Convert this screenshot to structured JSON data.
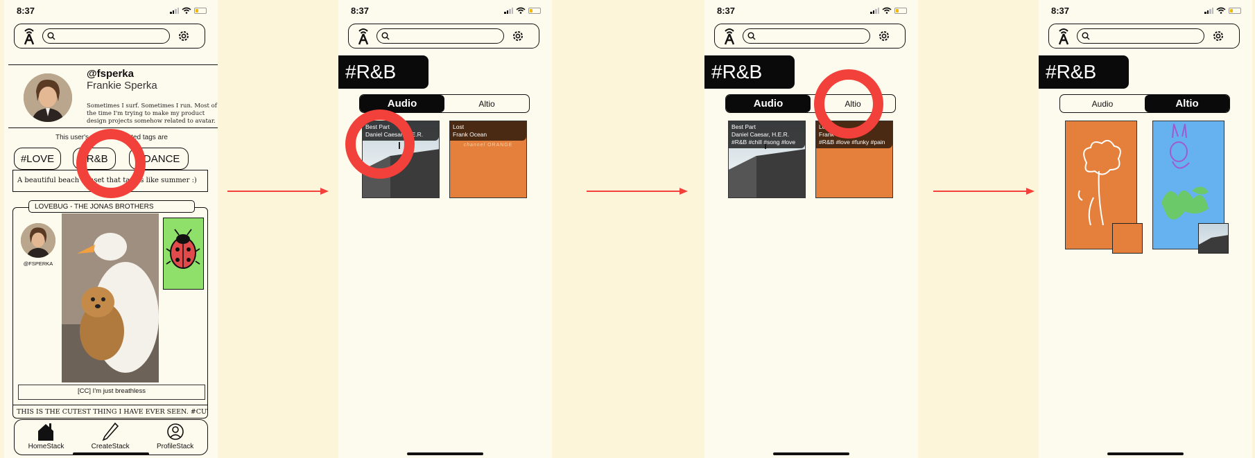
{
  "status": {
    "time": "8:37"
  },
  "profile": {
    "handle": "@fsperka",
    "name": "Frankie Sperka",
    "bio": "Sometimes I surf. Sometimes I run. Most of the time I'm trying to make my product design projects somehow related to avatar.",
    "tags_note": "This user's most frequented tags are",
    "tags": [
      "#LOVE",
      "#R&B",
      "#DANCE"
    ],
    "caption": "A beautiful beach sunset that tastes like summer :)",
    "post": {
      "song": "LOVEBUG - THE JONAS BROTHERS",
      "handle": "@FSPERKA",
      "cc": "[CC] I'm just breathless",
      "description": "THIS IS THE CUTEST THING I HAVE EVER SEEN. #CUTEST"
    },
    "nav": [
      "HomeStack",
      "CreateStack",
      "ProfileStack"
    ]
  },
  "rnb": {
    "hashtag": "#R&B",
    "tabs": [
      "Audio",
      "Altio"
    ],
    "albums": [
      {
        "title": "Best Part",
        "artist": "Daniel Caesar, H.E.R.",
        "tags": "#R&B #chill #song #love"
      },
      {
        "title": "Lost",
        "artist": "Frank Ocean",
        "tags": "#R&B #love #funky #pain"
      }
    ],
    "cover_text": "channel ORANGE",
    "cover_text_prefix": "channel",
    "cover_text_suffix": "ORANGE"
  },
  "colors": {
    "highlight_ring": "#f2403a",
    "background": "#fdf5da",
    "accent_green": "#8ee06a",
    "accent_orange": "#e4803c",
    "accent_blue": "#66b2f0"
  }
}
